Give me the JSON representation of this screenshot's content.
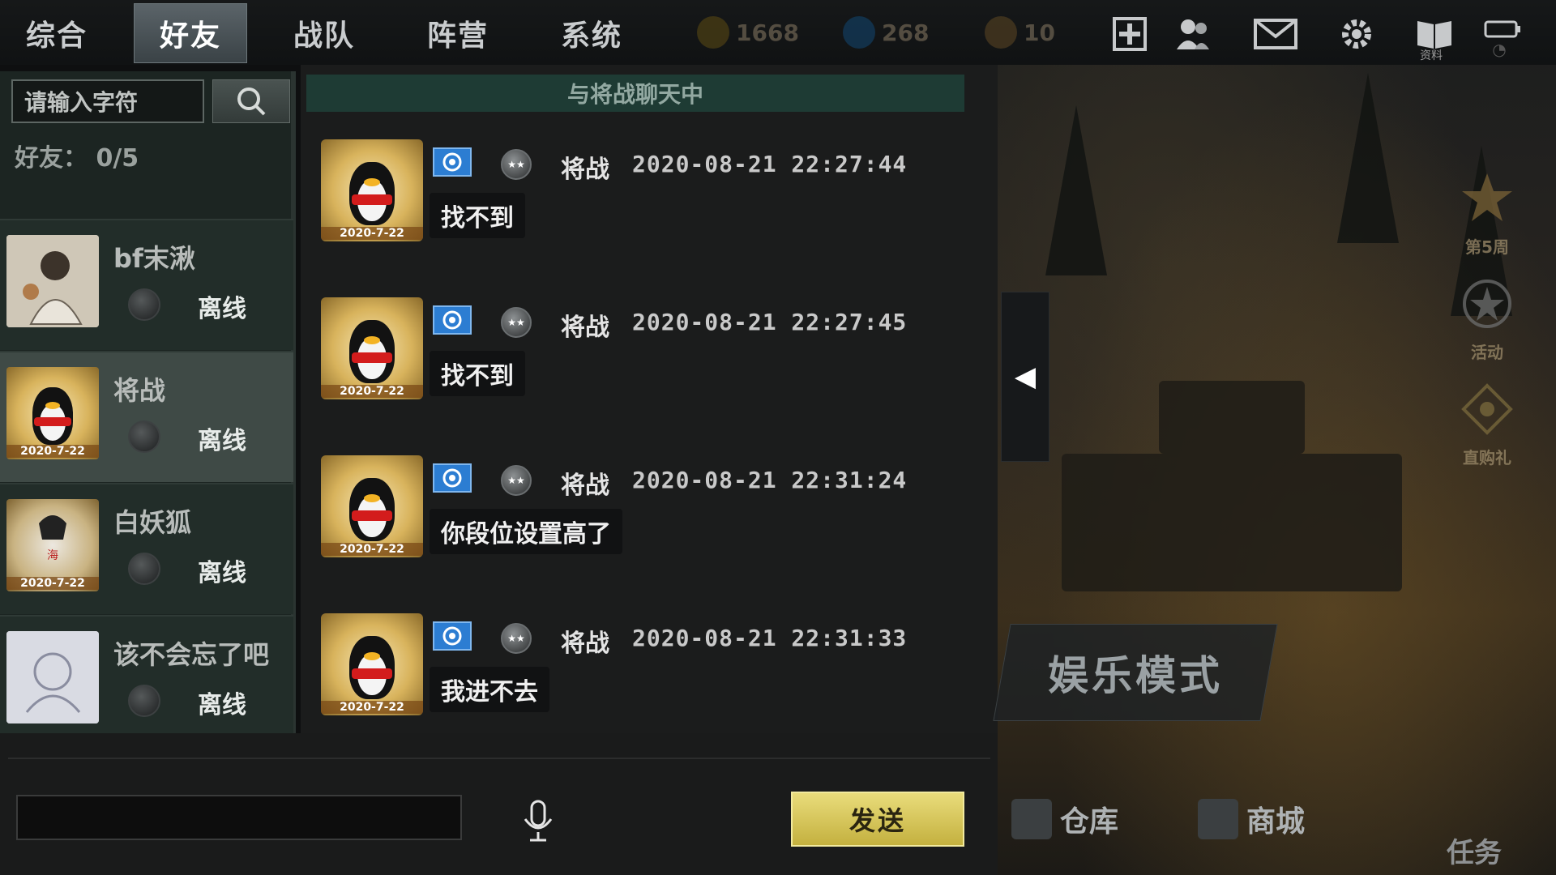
{
  "top_tabs": [
    "综合",
    "好友",
    "战队",
    "阵营",
    "系统"
  ],
  "active_tab": "好友",
  "resources": {
    "gold": "1668",
    "diamond": "268",
    "tickets": "10"
  },
  "top_icons": {
    "data_label": "资料"
  },
  "search": {
    "placeholder": "请输入字符"
  },
  "friend_count": "好友：  0/5",
  "friends": [
    {
      "name": "bf末湫",
      "status": "离线"
    },
    {
      "name": "将战",
      "status": "离线"
    },
    {
      "name": "白妖狐",
      "status": "离线"
    },
    {
      "name": "该不会忘了吧",
      "status": "离线"
    }
  ],
  "avatar_date": "2020-7-22",
  "chat": {
    "header": "与将战聊天中",
    "messages": [
      {
        "sender": "将战",
        "time": "2020-08-21 22:27:44",
        "text": "找不到"
      },
      {
        "sender": "将战",
        "time": "2020-08-21 22:27:45",
        "text": "找不到"
      },
      {
        "sender": "将战",
        "time": "2020-08-21 22:31:24",
        "text": "你段位设置高了"
      },
      {
        "sender": "将战",
        "time": "2020-08-21 22:31:33",
        "text": "我进不去"
      }
    ]
  },
  "send_button": "发送",
  "side_menu": [
    "第5周",
    "活动",
    "直购礼"
  ],
  "entertainment_mode": "娱乐模式",
  "bottom_nav": {
    "warehouse": "仓库",
    "shop": "商城",
    "task": "任务"
  },
  "colors": {
    "accent_gold": "#c4b13f",
    "chat_header": "#1e3b34",
    "badge_blue": "#2c7dd2"
  }
}
